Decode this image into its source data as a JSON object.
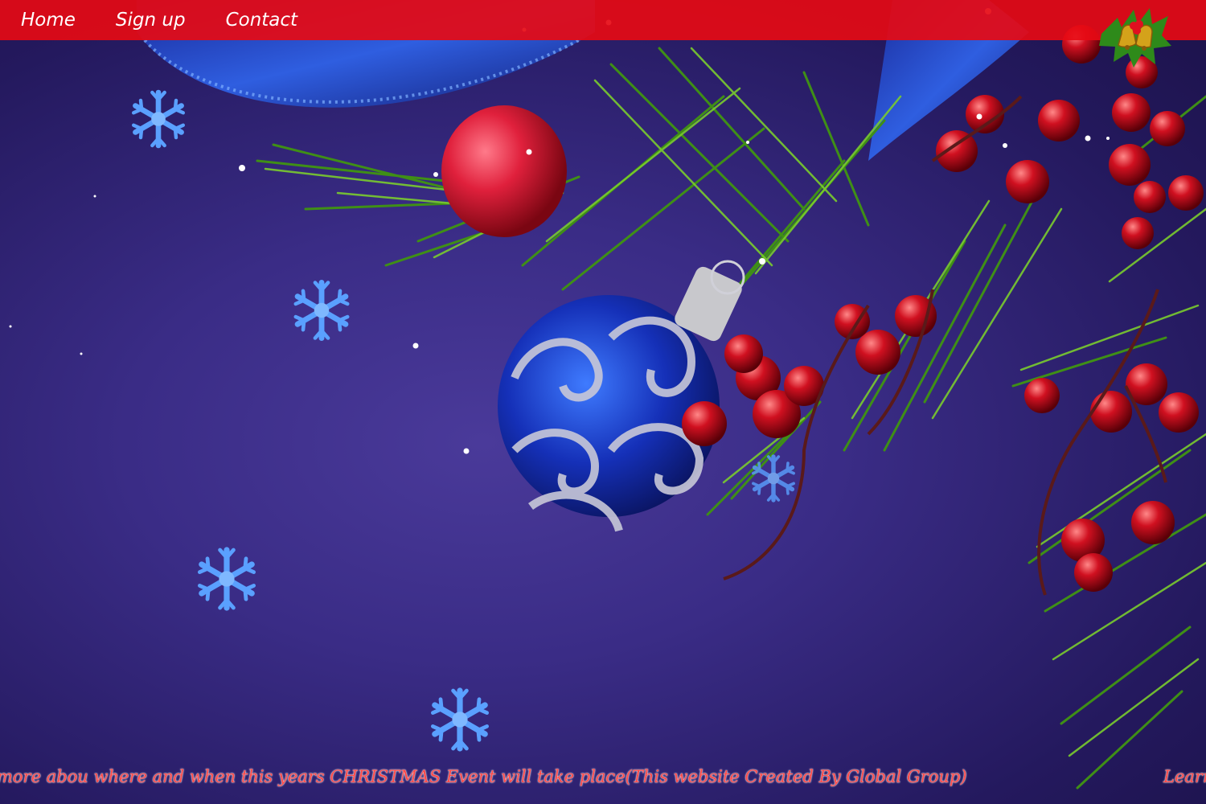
{
  "nav": {
    "items": [
      {
        "label": "Home"
      },
      {
        "label": "Sign up"
      },
      {
        "label": "Contact"
      }
    ]
  },
  "marquee": {
    "text": "more abou where and when this years CHRISTMAS Event will take place(This website Created By Global Group)",
    "next_text": "Learn"
  },
  "colors": {
    "navbar": "#e60a14",
    "background": "#3a2c86",
    "marquee_text": "#ff4a4a"
  }
}
